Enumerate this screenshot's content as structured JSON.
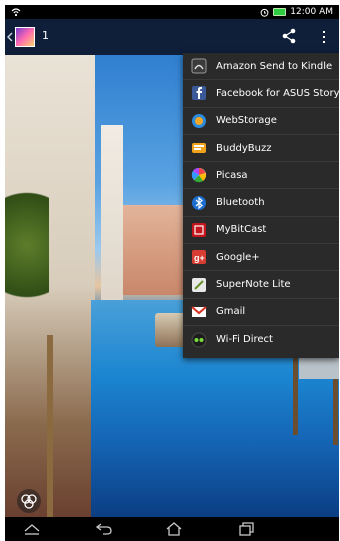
{
  "status_bar": {
    "time": "12:00 AM"
  },
  "action_bar": {
    "count": "1"
  },
  "share_menu": {
    "items": [
      {
        "label": "Amazon Send to Kindle",
        "icon": "kindle-icon"
      },
      {
        "label": "Facebook for ASUS Story",
        "icon": "facebook-icon"
      },
      {
        "label": "WebStorage",
        "icon": "webstorage-icon"
      },
      {
        "label": "BuddyBuzz",
        "icon": "buddybuzz-icon"
      },
      {
        "label": "Picasa",
        "icon": "picasa-icon"
      },
      {
        "label": "Bluetooth",
        "icon": "bluetooth-icon"
      },
      {
        "label": "MyBitCast",
        "icon": "mybitcast-icon"
      },
      {
        "label": "Google+",
        "icon": "google-plus-icon"
      },
      {
        "label": "SuperNote Lite",
        "icon": "supernote-icon"
      },
      {
        "label": "Gmail",
        "icon": "gmail-icon"
      },
      {
        "label": "Wi-Fi Direct",
        "icon": "wifi-direct-icon"
      }
    ]
  },
  "colors": {
    "action_bar": "#0f1f3a",
    "menu_background": "#2a2a2a",
    "battery": "#2ecc40"
  }
}
